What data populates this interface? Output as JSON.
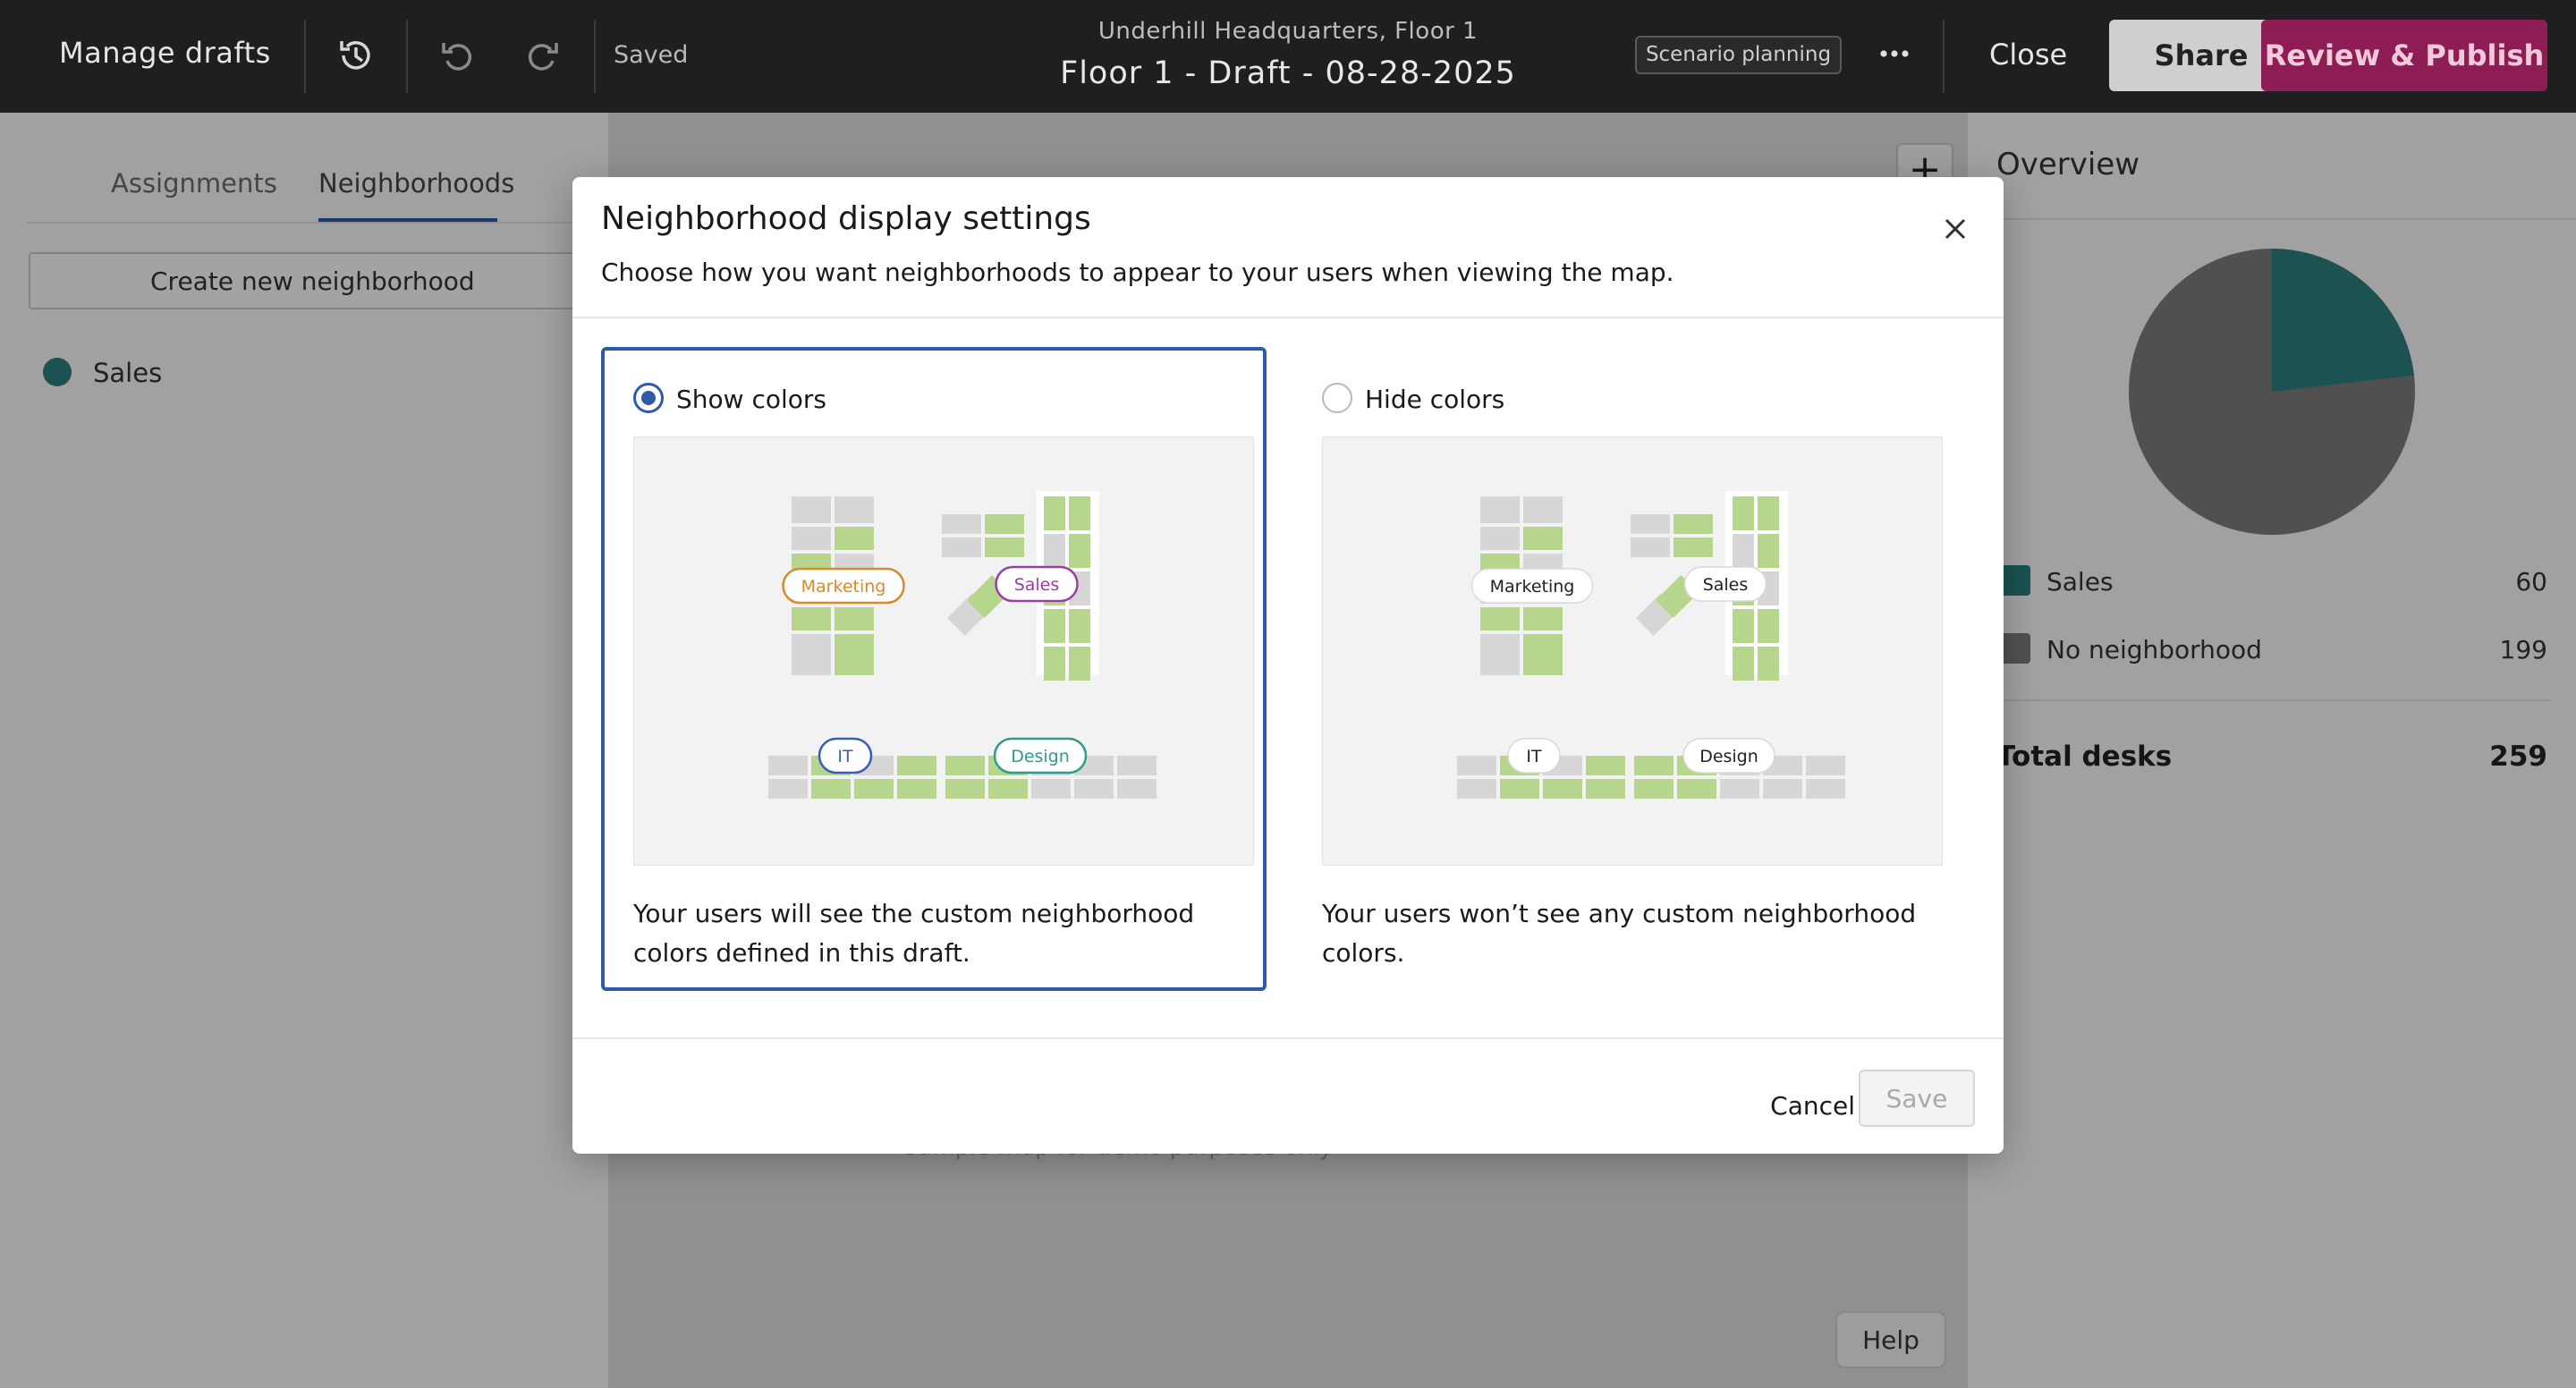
{
  "topbar": {
    "manage_drafts": "Manage drafts",
    "saved_status": "Saved",
    "building": "Underhill Headquarters, Floor 1",
    "draft_title": "Floor 1 - Draft - 08-28-2025",
    "scenario_badge": "Scenario planning",
    "close_label": "Close",
    "share_label": "Share",
    "publish_label": "Review & Publish",
    "icons": [
      "history-icon",
      "undo-icon",
      "redo-icon",
      "more-icon"
    ]
  },
  "left_panel": {
    "tabs": [
      {
        "label": "Assignments",
        "active": false
      },
      {
        "label": "Neighborhoods",
        "active": true
      }
    ],
    "create_button": "Create new neighborhood",
    "neighborhoods": [
      {
        "label": "Sales",
        "color": "#2b7f7e"
      }
    ]
  },
  "canvas": {
    "zoom_in": "+",
    "map_note": "Sample map for demo purposes only",
    "help_label": "Help"
  },
  "overview": {
    "title": "Overview",
    "legend": [
      {
        "label": "Sales",
        "value": "60",
        "color": "#2b7f7e"
      },
      {
        "label": "No neighborhood",
        "value": "199",
        "color": "#7c7c7c"
      }
    ],
    "total_label": "Total desks",
    "total_value": "259"
  },
  "modal": {
    "title": "Neighborhood display settings",
    "subtitle": "Choose how you want neighborhoods to appear to your users when viewing the map.",
    "options": [
      {
        "label": "Show colors",
        "selected": true,
        "description": "Your users will see the custom neighborhood colors defined in this draft.",
        "tags": [
          {
            "text": "Marketing",
            "color": "#d98a2b"
          },
          {
            "text": "Sales",
            "color": "#9c3fa3"
          },
          {
            "text": "IT",
            "color": "#3b5cb8"
          },
          {
            "text": "Design",
            "color": "#2e9c8c"
          }
        ]
      },
      {
        "label": "Hide colors",
        "selected": false,
        "description": "Your users won’t see any custom neighborhood colors.",
        "tags": [
          {
            "text": "Marketing",
            "color": "#222222"
          },
          {
            "text": "Sales",
            "color": "#222222"
          },
          {
            "text": "IT",
            "color": "#222222"
          },
          {
            "text": "Design",
            "color": "#222222"
          }
        ]
      }
    ],
    "cancel_label": "Cancel",
    "save_label": "Save"
  }
}
